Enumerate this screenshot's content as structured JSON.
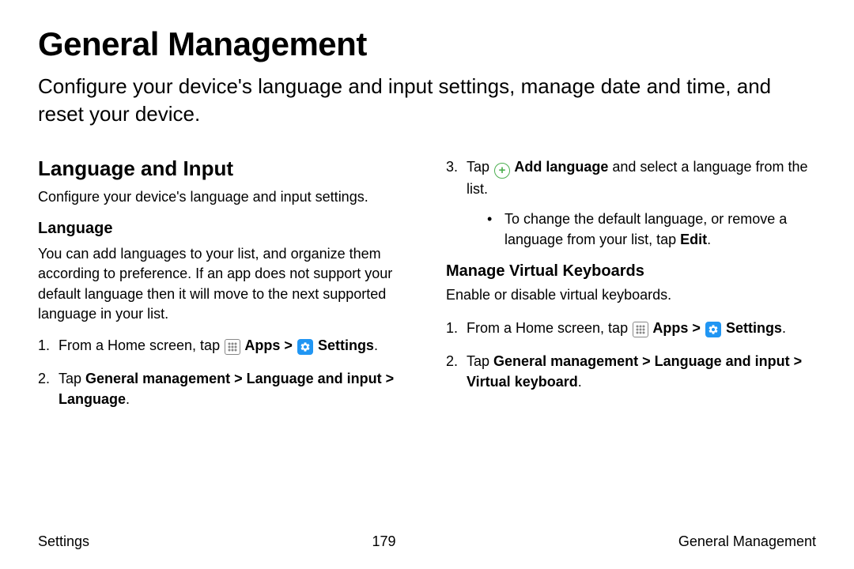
{
  "title": "General Management",
  "subtitle": "Configure your device's language and input settings, manage date and time, and reset your device.",
  "left": {
    "h2": "Language and Input",
    "desc": "Configure your device's language and input settings.",
    "h3": "Language",
    "body": "You can add languages to your list, and organize them according to preference. If an app does not support your default language then it will move to the next supported language in your list.",
    "step1_a": "From a Home screen, tap ",
    "step1_apps": " Apps",
    "step1_gt1": " > ",
    "step1_settings": " Settings",
    "step1_end": ".",
    "step2_a": "Tap ",
    "step2_b": "General management",
    "step2_gt1": " > ",
    "step2_c": "Language and input",
    "step2_gt2": " > ",
    "step2_d": "Language",
    "step2_end": "."
  },
  "right": {
    "step3_a": "Tap ",
    "step3_b": " Add language",
    "step3_c": " and select a language from the list.",
    "bullet_a": "To change the default language, or remove a language from your list, tap ",
    "bullet_b": "Edit",
    "bullet_end": ".",
    "h3": "Manage Virtual Keyboards",
    "desc": "Enable or disable virtual keyboards.",
    "step1_a": "From a Home screen, tap ",
    "step1_apps": " Apps",
    "step1_gt1": " > ",
    "step1_settings": " Settings",
    "step1_end": ".",
    "step2_a": "Tap ",
    "step2_b": "General management",
    "step2_gt1": " > ",
    "step2_c": "Language and input",
    "step2_gt2": " > ",
    "step2_d": "Virtual keyboard",
    "step2_end": "."
  },
  "footer": {
    "left": "Settings",
    "center": "179",
    "right": "General Management"
  }
}
